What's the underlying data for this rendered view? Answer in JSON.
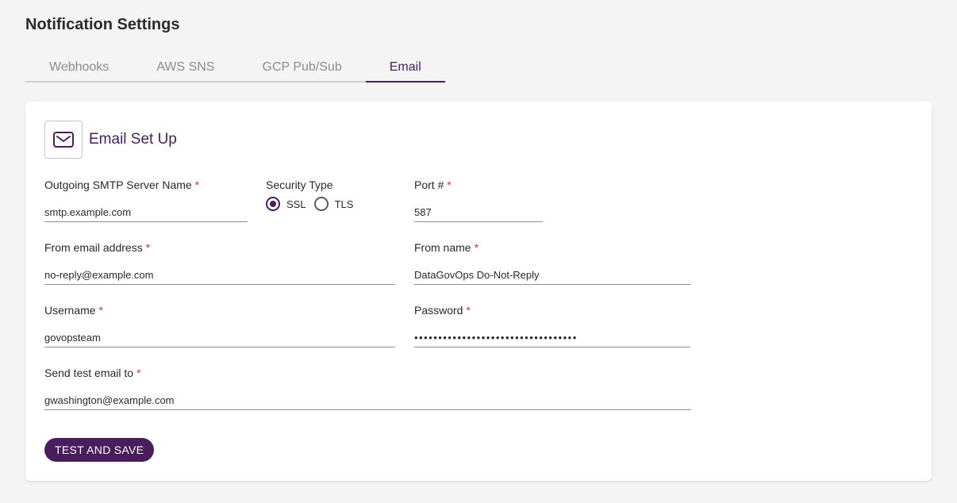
{
  "page": {
    "title": "Notification Settings"
  },
  "tabs": [
    {
      "label": "Webhooks"
    },
    {
      "label": "AWS SNS"
    },
    {
      "label": "GCP Pub/Sub"
    },
    {
      "label": "Email",
      "active": true
    }
  ],
  "card": {
    "title": "Email Set Up",
    "icon": "mail-icon",
    "smtp": {
      "label": "Outgoing SMTP Server Name",
      "value": "smtp.example.com",
      "required": "*"
    },
    "security": {
      "label": "Security Type",
      "options": [
        {
          "label": "SSL",
          "checked": true
        },
        {
          "label": "TLS",
          "checked": false
        }
      ]
    },
    "port": {
      "label": "Port #",
      "value": "587",
      "required": "*"
    },
    "from_email": {
      "label": "From email address",
      "value": "no-reply@example.com",
      "required": "*"
    },
    "from_name": {
      "label": "From name",
      "value": "DataGovOps Do-Not-Reply",
      "required": "*"
    },
    "username": {
      "label": "Username",
      "value": "govopsteam",
      "required": "*"
    },
    "password": {
      "label": "Password",
      "value": "••••••••••••••••••••••••••••••••••",
      "required": "*"
    },
    "test_email": {
      "label": "Send test email to",
      "value": "gwashington@example.com",
      "required": "*"
    },
    "submit_label": "TEST AND SAVE"
  },
  "colors": {
    "accent": "#4a1d5c",
    "required": "#d9363e",
    "background": "#f4f4f4"
  }
}
